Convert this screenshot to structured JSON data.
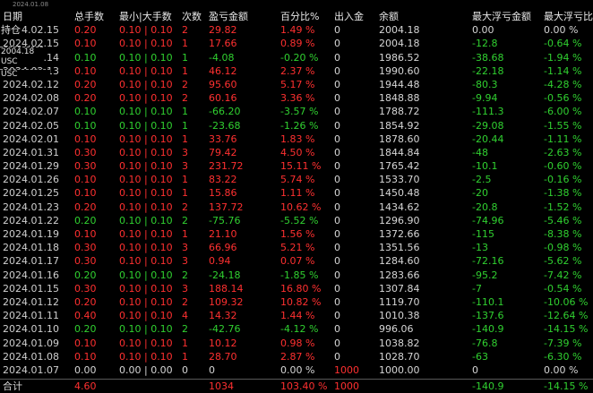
{
  "top_date": "2024.01.08",
  "headers": [
    "日期",
    "总手数",
    "最小|大手数",
    "次数",
    "盈亏金额",
    "百分比%",
    "出入金",
    "余额",
    "最大浮亏金额",
    "最大浮亏比例"
  ],
  "overlays": {
    "holding": "持仓",
    "price_label": "2004.18 USC",
    "currency": "USC"
  },
  "rows": [
    {
      "date": "2024.02.15",
      "lots": "0.20",
      "minmax": "0.10 | 0.10",
      "count": "2",
      "pnl": "29.82",
      "pct": "1.49 %",
      "io": "0",
      "balance": "2004.18",
      "maxdd": "0.00",
      "maxddpct": "0.00 %",
      "side": "red",
      "ddside": "white"
    },
    {
      "date": "2024.02.15",
      "lots": "0.10",
      "minmax": "0.10 | 0.10",
      "count": "1",
      "pnl": "17.66",
      "pct": "0.89 %",
      "io": "0",
      "balance": "2004.18",
      "maxdd": "-12.8",
      "maxddpct": "-0.64 %",
      "side": "red",
      "ddside": "green"
    },
    {
      "date": "2024.02.14",
      "lots": "0.10",
      "minmax": "0.10 | 0.10",
      "count": "1",
      "pnl": "-4.08",
      "pct": "-0.20 %",
      "io": "0",
      "balance": "1986.52",
      "maxdd": "-38.68",
      "maxddpct": "-1.94 %",
      "side": "green",
      "ddside": "green"
    },
    {
      "date": "2024.02.13",
      "lots": "0.10",
      "minmax": "0.10 | 0.10",
      "count": "1",
      "pnl": "46.12",
      "pct": "2.37 %",
      "io": "0",
      "balance": "1990.60",
      "maxdd": "-22.18",
      "maxddpct": "-1.14 %",
      "side": "red",
      "ddside": "green"
    },
    {
      "date": "2024.02.12",
      "lots": "0.20",
      "minmax": "0.10 | 0.10",
      "count": "2",
      "pnl": "95.60",
      "pct": "5.17 %",
      "io": "0",
      "balance": "1944.48",
      "maxdd": "-80.3",
      "maxddpct": "-4.28 %",
      "side": "red",
      "ddside": "green"
    },
    {
      "date": "2024.02.08",
      "lots": "0.20",
      "minmax": "0.10 | 0.10",
      "count": "2",
      "pnl": "60.16",
      "pct": "3.36 %",
      "io": "0",
      "balance": "1848.88",
      "maxdd": "-9.94",
      "maxddpct": "-0.56 %",
      "side": "red",
      "ddside": "green"
    },
    {
      "date": "2024.02.07",
      "lots": "0.10",
      "minmax": "0.10 | 0.10",
      "count": "1",
      "pnl": "-66.20",
      "pct": "-3.57 %",
      "io": "0",
      "balance": "1788.72",
      "maxdd": "-111.3",
      "maxddpct": "-6.00 %",
      "side": "green",
      "ddside": "green"
    },
    {
      "date": "2024.02.05",
      "lots": "0.10",
      "minmax": "0.10 | 0.10",
      "count": "1",
      "pnl": "-23.68",
      "pct": "-1.26 %",
      "io": "0",
      "balance": "1854.92",
      "maxdd": "-29.08",
      "maxddpct": "-1.55 %",
      "side": "green",
      "ddside": "green"
    },
    {
      "date": "2024.02.01",
      "lots": "0.10",
      "minmax": "0.10 | 0.10",
      "count": "1",
      "pnl": "33.76",
      "pct": "1.83 %",
      "io": "0",
      "balance": "1878.60",
      "maxdd": "-20.44",
      "maxddpct": "-1.11 %",
      "side": "red",
      "ddside": "green"
    },
    {
      "date": "2024.01.31",
      "lots": "0.30",
      "minmax": "0.10 | 0.10",
      "count": "3",
      "pnl": "79.42",
      "pct": "4.50 %",
      "io": "0",
      "balance": "1844.84",
      "maxdd": "-48",
      "maxddpct": "-2.63 %",
      "side": "red",
      "ddside": "green"
    },
    {
      "date": "2024.01.29",
      "lots": "0.30",
      "minmax": "0.10 | 0.10",
      "count": "3",
      "pnl": "231.72",
      "pct": "15.11 %",
      "io": "0",
      "balance": "1765.42",
      "maxdd": "-10.1",
      "maxddpct": "-0.60 %",
      "side": "red",
      "ddside": "green"
    },
    {
      "date": "2024.01.26",
      "lots": "0.10",
      "minmax": "0.10 | 0.10",
      "count": "1",
      "pnl": "83.22",
      "pct": "5.74 %",
      "io": "0",
      "balance": "1533.70",
      "maxdd": "-2.5",
      "maxddpct": "-0.16 %",
      "side": "red",
      "ddside": "green"
    },
    {
      "date": "2024.01.25",
      "lots": "0.10",
      "minmax": "0.10 | 0.10",
      "count": "1",
      "pnl": "15.86",
      "pct": "1.11 %",
      "io": "0",
      "balance": "1450.48",
      "maxdd": "-20",
      "maxddpct": "-1.38 %",
      "side": "red",
      "ddside": "green"
    },
    {
      "date": "2024.01.23",
      "lots": "0.20",
      "minmax": "0.10 | 0.10",
      "count": "2",
      "pnl": "137.72",
      "pct": "10.62 %",
      "io": "0",
      "balance": "1434.62",
      "maxdd": "-20.8",
      "maxddpct": "-1.52 %",
      "side": "red",
      "ddside": "green"
    },
    {
      "date": "2024.01.22",
      "lots": "0.20",
      "minmax": "0.10 | 0.10",
      "count": "2",
      "pnl": "-75.76",
      "pct": "-5.52 %",
      "io": "0",
      "balance": "1296.90",
      "maxdd": "-74.96",
      "maxddpct": "-5.46 %",
      "side": "green",
      "ddside": "green"
    },
    {
      "date": "2024.01.19",
      "lots": "0.10",
      "minmax": "0.10 | 0.10",
      "count": "1",
      "pnl": "21.10",
      "pct": "1.56 %",
      "io": "0",
      "balance": "1372.66",
      "maxdd": "-115",
      "maxddpct": "-8.38 %",
      "side": "red",
      "ddside": "green"
    },
    {
      "date": "2024.01.18",
      "lots": "0.30",
      "minmax": "0.10 | 0.10",
      "count": "3",
      "pnl": "66.96",
      "pct": "5.21 %",
      "io": "0",
      "balance": "1351.56",
      "maxdd": "-13",
      "maxddpct": "-0.98 %",
      "side": "red",
      "ddside": "green"
    },
    {
      "date": "2024.01.17",
      "lots": "0.30",
      "minmax": "0.10 | 0.10",
      "count": "3",
      "pnl": "0.94",
      "pct": "0.07 %",
      "io": "0",
      "balance": "1284.60",
      "maxdd": "-72.16",
      "maxddpct": "-5.62 %",
      "side": "red",
      "ddside": "green"
    },
    {
      "date": "2024.01.16",
      "lots": "0.20",
      "minmax": "0.10 | 0.10",
      "count": "2",
      "pnl": "-24.18",
      "pct": "-1.85 %",
      "io": "0",
      "balance": "1283.66",
      "maxdd": "-95.2",
      "maxddpct": "-7.42 %",
      "side": "green",
      "ddside": "green"
    },
    {
      "date": "2024.01.15",
      "lots": "0.30",
      "minmax": "0.10 | 0.10",
      "count": "3",
      "pnl": "188.14",
      "pct": "16.80 %",
      "io": "0",
      "balance": "1307.84",
      "maxdd": "-7",
      "maxddpct": "-0.54 %",
      "side": "red",
      "ddside": "green"
    },
    {
      "date": "2024.01.12",
      "lots": "0.20",
      "minmax": "0.10 | 0.10",
      "count": "2",
      "pnl": "109.32",
      "pct": "10.82 %",
      "io": "0",
      "balance": "1119.70",
      "maxdd": "-110.1",
      "maxddpct": "-10.06 %",
      "side": "red",
      "ddside": "green"
    },
    {
      "date": "2024.01.11",
      "lots": "0.40",
      "minmax": "0.10 | 0.10",
      "count": "4",
      "pnl": "14.32",
      "pct": "1.44 %",
      "io": "0",
      "balance": "1010.38",
      "maxdd": "-137.6",
      "maxddpct": "-12.64 %",
      "side": "red",
      "ddside": "green"
    },
    {
      "date": "2024.01.10",
      "lots": "0.20",
      "minmax": "0.10 | 0.10",
      "count": "2",
      "pnl": "-42.76",
      "pct": "-4.12 %",
      "io": "0",
      "balance": "996.06",
      "maxdd": "-140.9",
      "maxddpct": "-14.15 %",
      "side": "green",
      "ddside": "green"
    },
    {
      "date": "2024.01.09",
      "lots": "0.10",
      "minmax": "0.10 | 0.10",
      "count": "1",
      "pnl": "10.12",
      "pct": "0.98 %",
      "io": "0",
      "balance": "1038.82",
      "maxdd": "-76.8",
      "maxddpct": "-7.39 %",
      "side": "red",
      "ddside": "green"
    },
    {
      "date": "2024.01.08",
      "lots": "0.10",
      "minmax": "0.10 | 0.10",
      "count": "1",
      "pnl": "28.70",
      "pct": "2.87 %",
      "io": "0",
      "balance": "1028.70",
      "maxdd": "-63",
      "maxddpct": "-6.30 %",
      "side": "red",
      "ddside": "green"
    },
    {
      "date": "2024.01.07",
      "lots": "0.00",
      "minmax": "0.00 | 0.00",
      "count": "0",
      "pnl": "0",
      "pct": "0.00 %",
      "io": "1000",
      "balance": "1000.00",
      "maxdd": "0",
      "maxddpct": "0.00 %",
      "side": "white",
      "ddside": "white",
      "ioside": "red"
    }
  ],
  "total": {
    "label": "合计",
    "lots": "4.60",
    "pnl": "1034",
    "pct": "103.40 %",
    "io": "1000",
    "maxdd": "-140.9",
    "maxddpct": "-14.15 %"
  }
}
